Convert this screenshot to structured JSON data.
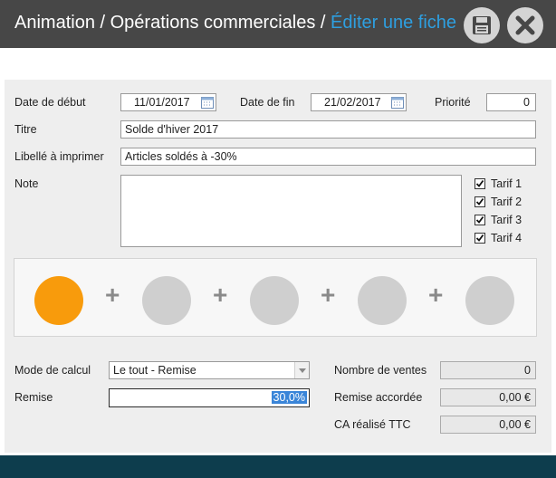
{
  "header": {
    "breadcrumb_root": "Animation / Opérations commerciales / ",
    "breadcrumb_current": "Éditer une fiche",
    "save_icon": "floppy-save-icon",
    "close_icon": "close-x-icon"
  },
  "form": {
    "date_start_label": "Date de début",
    "date_start_value": "11/01/2017",
    "date_end_label": "Date de fin",
    "date_end_value": "21/02/2017",
    "priority_label": "Priorité",
    "priority_value": "0",
    "title_label": "Titre",
    "title_value": "Solde d'hiver 2017",
    "print_label_label": "Libellé à imprimer",
    "print_label_value": "Articles soldés à -30%",
    "note_label": "Note",
    "note_value": "",
    "tariffs": [
      {
        "label": "Tarif 1",
        "checked": true
      },
      {
        "label": "Tarif 2",
        "checked": true
      },
      {
        "label": "Tarif 3",
        "checked": true
      },
      {
        "label": "Tarif 4",
        "checked": true
      }
    ]
  },
  "steps": {
    "count": 5,
    "active_index": 0,
    "separator": "+"
  },
  "calc": {
    "mode_label": "Mode de calcul",
    "mode_value": "Le tout - Remise",
    "discount_label": "Remise",
    "discount_value": "30,0%",
    "sales_count_label": "Nombre de ventes",
    "sales_count_value": "0",
    "granted_discount_label": "Remise accordée",
    "granted_discount_value": "0,00 €",
    "revenue_label": "CA réalisé TTC",
    "revenue_value": "0,00 €"
  },
  "colors": {
    "title_bar": "#474747",
    "accent_blue": "#2e9fe0",
    "active_step": "#f89b0c",
    "inactive_step": "#cfcfcf",
    "bottom_bar": "#0d3d4d"
  }
}
